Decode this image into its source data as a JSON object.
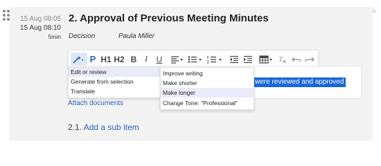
{
  "close_glyph": "×",
  "meta": {
    "start": "15 Aug 08:05",
    "end": "15 Aug 08:10",
    "duration": "5min"
  },
  "item": {
    "title": "2. Approval of Previous Meeting Minutes",
    "type": "Decision",
    "owner": "Paula Miller"
  },
  "toolbar": {
    "buttons": [
      {
        "name": "ai-wand-icon",
        "label": ""
      },
      {
        "name": "paragraph-button",
        "label": "P"
      },
      {
        "name": "heading1-button",
        "label": "H1"
      },
      {
        "name": "heading2-button",
        "label": "H2"
      },
      {
        "name": "bold-button",
        "label": "B"
      },
      {
        "name": "italic-button",
        "label": "I"
      },
      {
        "name": "underline-button",
        "label": "U"
      }
    ]
  },
  "ai_menu": {
    "items": [
      "Edit or review",
      "Generate from selection",
      "Translate"
    ],
    "selected_index": 0
  },
  "ai_submenu": {
    "items": [
      "Improve writing",
      "Make shorter",
      "Make longer",
      "Change Tone: \"Professional\""
    ],
    "selected_index": 2
  },
  "editor": {
    "selected_text": "were reviewed and approved"
  },
  "attach_label": "Attach documents",
  "subitem": {
    "number": "2.1.",
    "label": "Add a sub item"
  },
  "colors": {
    "accent": "#2b62b8",
    "selection": "#1a66d9",
    "active_button": "#dce8f7"
  }
}
